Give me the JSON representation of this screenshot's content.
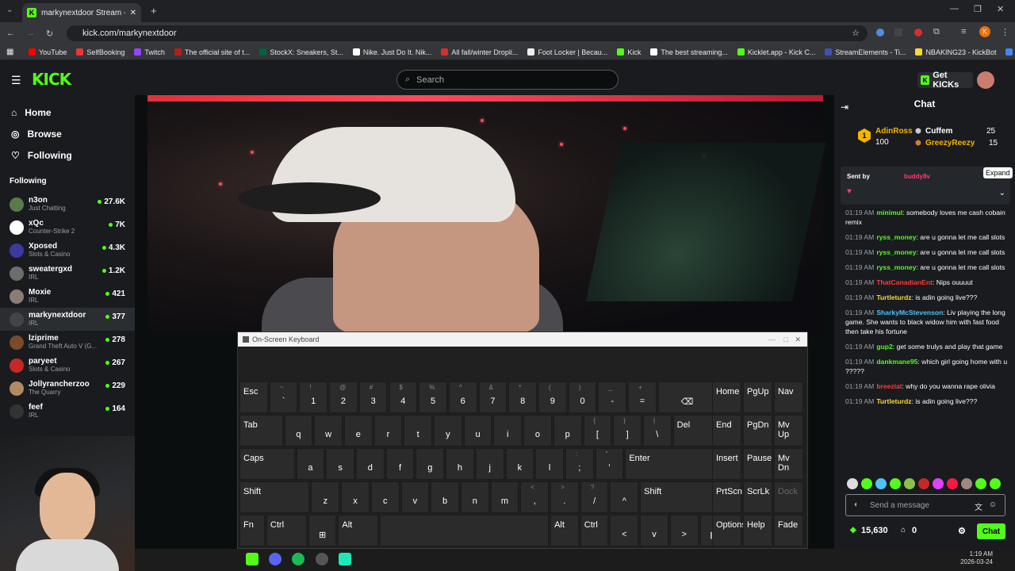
{
  "browser": {
    "tab_title": "markynextdoor Stream - W",
    "url": "kick.com/markynextdoor",
    "bookmarks": [
      {
        "label": "YouTube",
        "color": "#ff0000"
      },
      {
        "label": "SelfBooking",
        "color": "#e53935"
      },
      {
        "label": "Twitch",
        "color": "#9146ff"
      },
      {
        "label": "The official site of t...",
        "color": "#b71c1c"
      },
      {
        "label": "StockX: Sneakers, St...",
        "color": "#006340"
      },
      {
        "label": "Nike. Just Do It. Nik...",
        "color": "#ffffff"
      },
      {
        "label": "All fall/winter Dropli...",
        "color": "#d32f2f"
      },
      {
        "label": "Foot Locker | Becau...",
        "color": "#eeeeee"
      },
      {
        "label": "Kick",
        "color": "#53fc18"
      },
      {
        "label": "The best streaming...",
        "color": "#ffffff"
      },
      {
        "label": "Kicklet.app - Kick C...",
        "color": "#53fc18"
      },
      {
        "label": "StreamElements - Ti...",
        "color": "#3f51b5"
      },
      {
        "label": "NBAKING23 - KickBot",
        "color": "#fdd835"
      },
      {
        "label": "Google",
        "color": "#4285f4"
      }
    ],
    "profile_letter": "K"
  },
  "header": {
    "logo": "KICK",
    "search_placeholder": "Search",
    "get_kicks": "Get KICKs"
  },
  "sidebar": {
    "nav": [
      {
        "label": "Home",
        "icon": "home-icon"
      },
      {
        "label": "Browse",
        "icon": "compass-icon"
      },
      {
        "label": "Following",
        "icon": "heart-icon"
      }
    ],
    "following_title": "Following",
    "channels": [
      {
        "name": "n3on",
        "category": "Just Chatting",
        "viewers": "27.6K",
        "color": "#5b7a4a"
      },
      {
        "name": "xQc",
        "category": "Counter-Strike 2",
        "viewers": "7K",
        "color": "#ffffff"
      },
      {
        "name": "Xposed",
        "category": "Slots & Casino",
        "viewers": "4.3K",
        "color": "#3a3aa0"
      },
      {
        "name": "sweatergxd",
        "category": "IRL",
        "viewers": "1.2K",
        "color": "#6d6d6d"
      },
      {
        "name": "Moxie",
        "category": "IRL",
        "viewers": "421",
        "color": "#8a7d74"
      },
      {
        "name": "markynextdoor",
        "category": "IRL",
        "viewers": "377",
        "color": "#444"
      },
      {
        "name": "lziprime",
        "category": "Grand Theft Auto V (G...",
        "viewers": "278",
        "color": "#7a4a2a"
      },
      {
        "name": "paryeet",
        "category": "Slots & Casino",
        "viewers": "267",
        "color": "#c62828"
      },
      {
        "name": "Jollyrancherzoo",
        "category": "The Quarry",
        "viewers": "229",
        "color": "#b08a60"
      },
      {
        "name": "feef",
        "category": "IRL",
        "viewers": "164",
        "color": "#333"
      }
    ]
  },
  "osk": {
    "title": "On-Screen Keyboard",
    "rows": [
      [
        {
          "l": "Esc",
          "s": ""
        },
        {
          "l": "`",
          "s": "~"
        },
        {
          "l": "1",
          "s": "!"
        },
        {
          "l": "2",
          "s": "@"
        },
        {
          "l": "3",
          "s": "#"
        },
        {
          "l": "4",
          "s": "$"
        },
        {
          "l": "5",
          "s": "%"
        },
        {
          "l": "6",
          "s": "^"
        },
        {
          "l": "7",
          "s": "&"
        },
        {
          "l": "8",
          "s": "*"
        },
        {
          "l": "9",
          "s": "("
        },
        {
          "l": "0",
          "s": ")"
        },
        {
          "l": "-",
          "s": "_"
        },
        {
          "l": "=",
          "s": "+"
        },
        {
          "l": "⌫",
          "s": ""
        }
      ],
      [
        {
          "l": "Tab",
          "s": ""
        },
        {
          "l": "q",
          "s": ""
        },
        {
          "l": "w",
          "s": ""
        },
        {
          "l": "e",
          "s": ""
        },
        {
          "l": "r",
          "s": ""
        },
        {
          "l": "t",
          "s": ""
        },
        {
          "l": "y",
          "s": ""
        },
        {
          "l": "u",
          "s": ""
        },
        {
          "l": "i",
          "s": ""
        },
        {
          "l": "o",
          "s": ""
        },
        {
          "l": "p",
          "s": ""
        },
        {
          "l": "[",
          "s": "{"
        },
        {
          "l": "]",
          "s": "}"
        },
        {
          "l": "\\",
          "s": "|"
        },
        {
          "l": "Del",
          "s": ""
        }
      ],
      [
        {
          "l": "Caps",
          "s": ""
        },
        {
          "l": "a",
          "s": ""
        },
        {
          "l": "s",
          "s": ""
        },
        {
          "l": "d",
          "s": ""
        },
        {
          "l": "f",
          "s": ""
        },
        {
          "l": "g",
          "s": ""
        },
        {
          "l": "h",
          "s": ""
        },
        {
          "l": "j",
          "s": ""
        },
        {
          "l": "k",
          "s": ""
        },
        {
          "l": "l",
          "s": ""
        },
        {
          "l": ";",
          "s": ":"
        },
        {
          "l": "'",
          "s": "\""
        },
        {
          "l": "Enter",
          "s": ""
        }
      ],
      [
        {
          "l": "Shift",
          "s": ""
        },
        {
          "l": "z",
          "s": ""
        },
        {
          "l": "x",
          "s": ""
        },
        {
          "l": "c",
          "s": ""
        },
        {
          "l": "v",
          "s": ""
        },
        {
          "l": "b",
          "s": ""
        },
        {
          "l": "n",
          "s": ""
        },
        {
          "l": "m",
          "s": ""
        },
        {
          "l": ",",
          "s": "<"
        },
        {
          "l": ".",
          "s": ">"
        },
        {
          "l": "/",
          "s": "?"
        },
        {
          "l": "^",
          "s": ""
        },
        {
          "l": "Shift",
          "s": ""
        }
      ],
      [
        {
          "l": "Fn",
          "s": ""
        },
        {
          "l": "Ctrl",
          "s": ""
        },
        {
          "l": "⊞",
          "s": ""
        },
        {
          "l": "Alt",
          "s": ""
        },
        {
          "l": "",
          "s": ""
        },
        {
          "l": "Alt",
          "s": ""
        },
        {
          "l": "Ctrl",
          "s": ""
        },
        {
          "l": "<",
          "s": ""
        },
        {
          "l": "v",
          "s": ""
        },
        {
          "l": ">",
          "s": ""
        },
        {
          "l": "▦",
          "s": ""
        }
      ]
    ],
    "side": [
      [
        "Home",
        "PgUp",
        "Nav"
      ],
      [
        "End",
        "PgDn",
        "Mv Up"
      ],
      [
        "Insert",
        "Pause",
        "Mv Dn"
      ],
      [
        "PrtScn",
        "ScrLk",
        "Dock"
      ],
      [
        "Options",
        "Help",
        "Fade"
      ]
    ]
  },
  "chat": {
    "title": "Chat",
    "leaderboard": {
      "rank1_name": "AdinRoss",
      "rank1_value": "100",
      "rank2_name": "Cuffem",
      "rank2_value": "25",
      "rank3_name": "GreezyReezy",
      "rank3_value": "15"
    },
    "pinned": {
      "sent_by": "Sent by",
      "user": "buddy8v",
      "expand_tooltip": "Expand"
    },
    "messages": [
      {
        "time": "01:19 AM",
        "user": "minimul",
        "color": "#53fc18",
        "text": "somebody loves me cash cobain remix"
      },
      {
        "time": "01:19 AM",
        "user": "ryss_money",
        "color": "#53fc18",
        "text": "are u gonna let me call slots"
      },
      {
        "time": "01:19 AM",
        "user": "ryss_money",
        "color": "#53fc18",
        "text": "are u gonna let me call slots"
      },
      {
        "time": "01:19 AM",
        "user": "ryss_money",
        "color": "#53fc18",
        "text": "are u gonna let me call slots"
      },
      {
        "time": "01:19 AM",
        "user": "ThatCanadianEnt",
        "color": "#ff3b3b",
        "text": "Nips ouuuut"
      },
      {
        "time": "01:19 AM",
        "user": "Turtleturdz",
        "color": "#fdd835",
        "text": "is adin going live???"
      },
      {
        "time": "01:19 AM",
        "user": "SharkyMcStevenson",
        "color": "#4fc3f7",
        "text": "Liv playing the long game. She wants to black widow him with fast food then take his fortune"
      },
      {
        "time": "01:19 AM",
        "user": "gup2",
        "color": "#53fc18",
        "text": "get some trulys and play that game"
      },
      {
        "time": "01:19 AM",
        "user": "dankmane95",
        "color": "#53fc18",
        "text": "which girl going home with u ?????"
      },
      {
        "time": "01:19 AM",
        "user": "breezial",
        "color": "#ff3b3b",
        "text": "why do you wanna rape olivia"
      },
      {
        "time": "01:19 AM",
        "user": "Turtleturdz",
        "color": "#fdd835",
        "text": "is adin going live???"
      }
    ],
    "input_placeholder": "Send a message",
    "points": "15,630",
    "gift_count": "0",
    "send_label": "Chat"
  },
  "taskbar": {
    "time": "1:19 AM",
    "date": "2026-03-24"
  }
}
